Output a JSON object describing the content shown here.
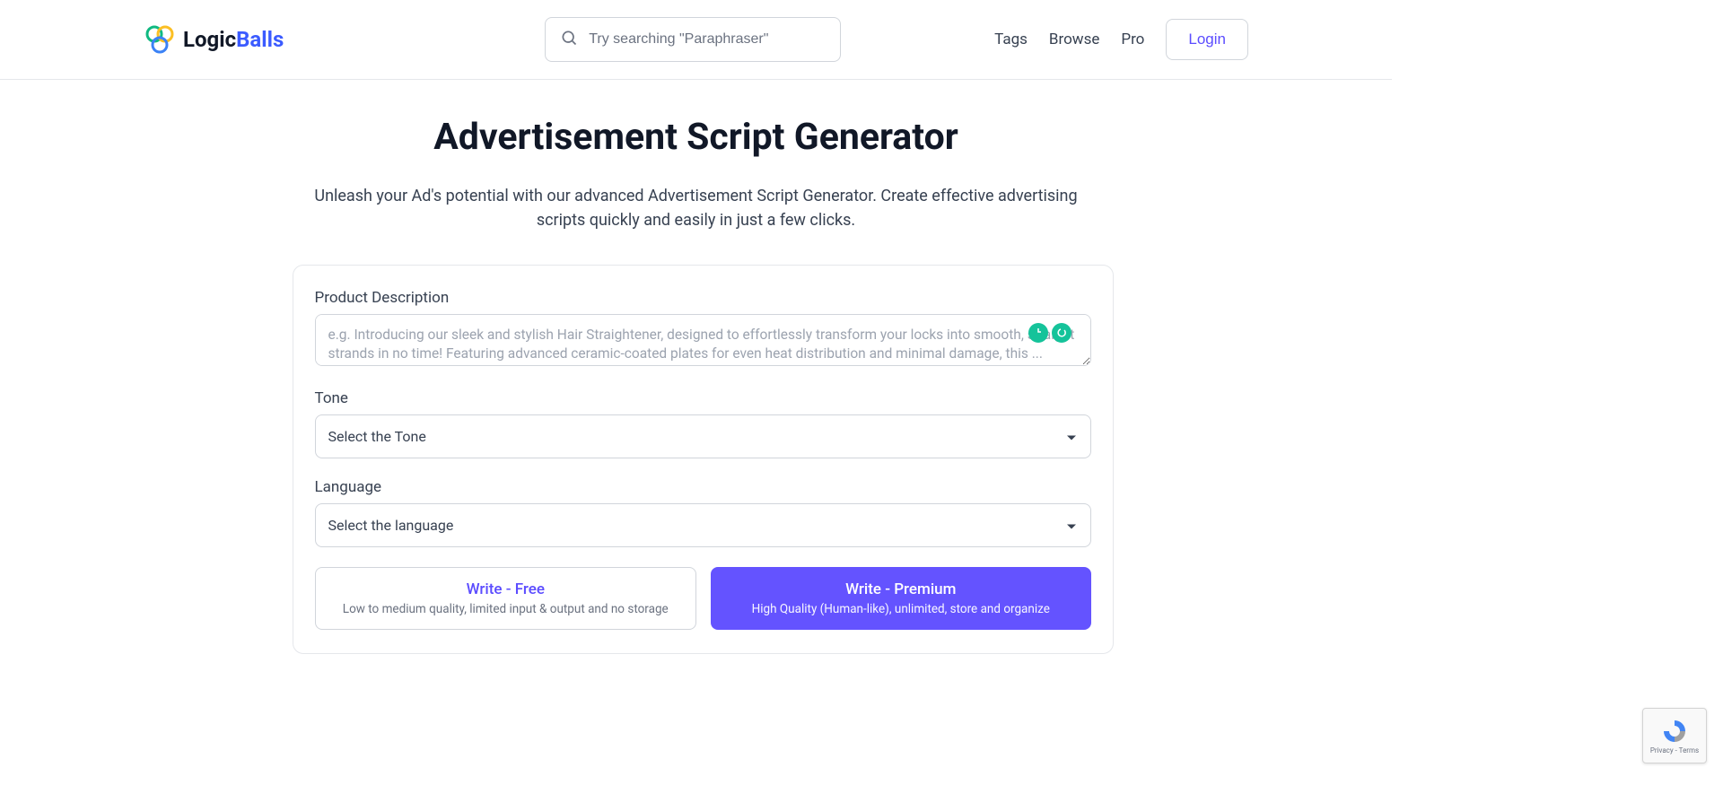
{
  "header": {
    "logo_part1": "Logic",
    "logo_part2": "Balls",
    "search_placeholder": "Try searching \"Paraphraser\"",
    "nav": {
      "tags": "Tags",
      "browse": "Browse",
      "pro": "Pro",
      "login": "Login"
    }
  },
  "main": {
    "title": "Advertisement Script Generator",
    "subtitle": "Unleash your Ad's potential with our advanced Advertisement Script Generator. Create effective advertising scripts quickly and easily in just a few clicks."
  },
  "form": {
    "product_description_label": "Product Description",
    "product_description_placeholder": "e.g. Introducing our sleek and stylish Hair Straightener, designed to effortlessly transform your locks into smooth, straight strands in no time! Featuring advanced ceramic-coated plates for even heat distribution and minimal damage, this ...",
    "tone_label": "Tone",
    "tone_placeholder": "Select the Tone",
    "language_label": "Language",
    "language_placeholder": "Select the language",
    "free_button_title": "Write - Free",
    "free_button_sub": "Low to medium quality, limited input & output and no storage",
    "premium_button_title": "Write - Premium",
    "premium_button_sub": "High Quality (Human-like), unlimited, store and organize"
  },
  "recaptcha": {
    "text": "Privacy - Terms"
  }
}
